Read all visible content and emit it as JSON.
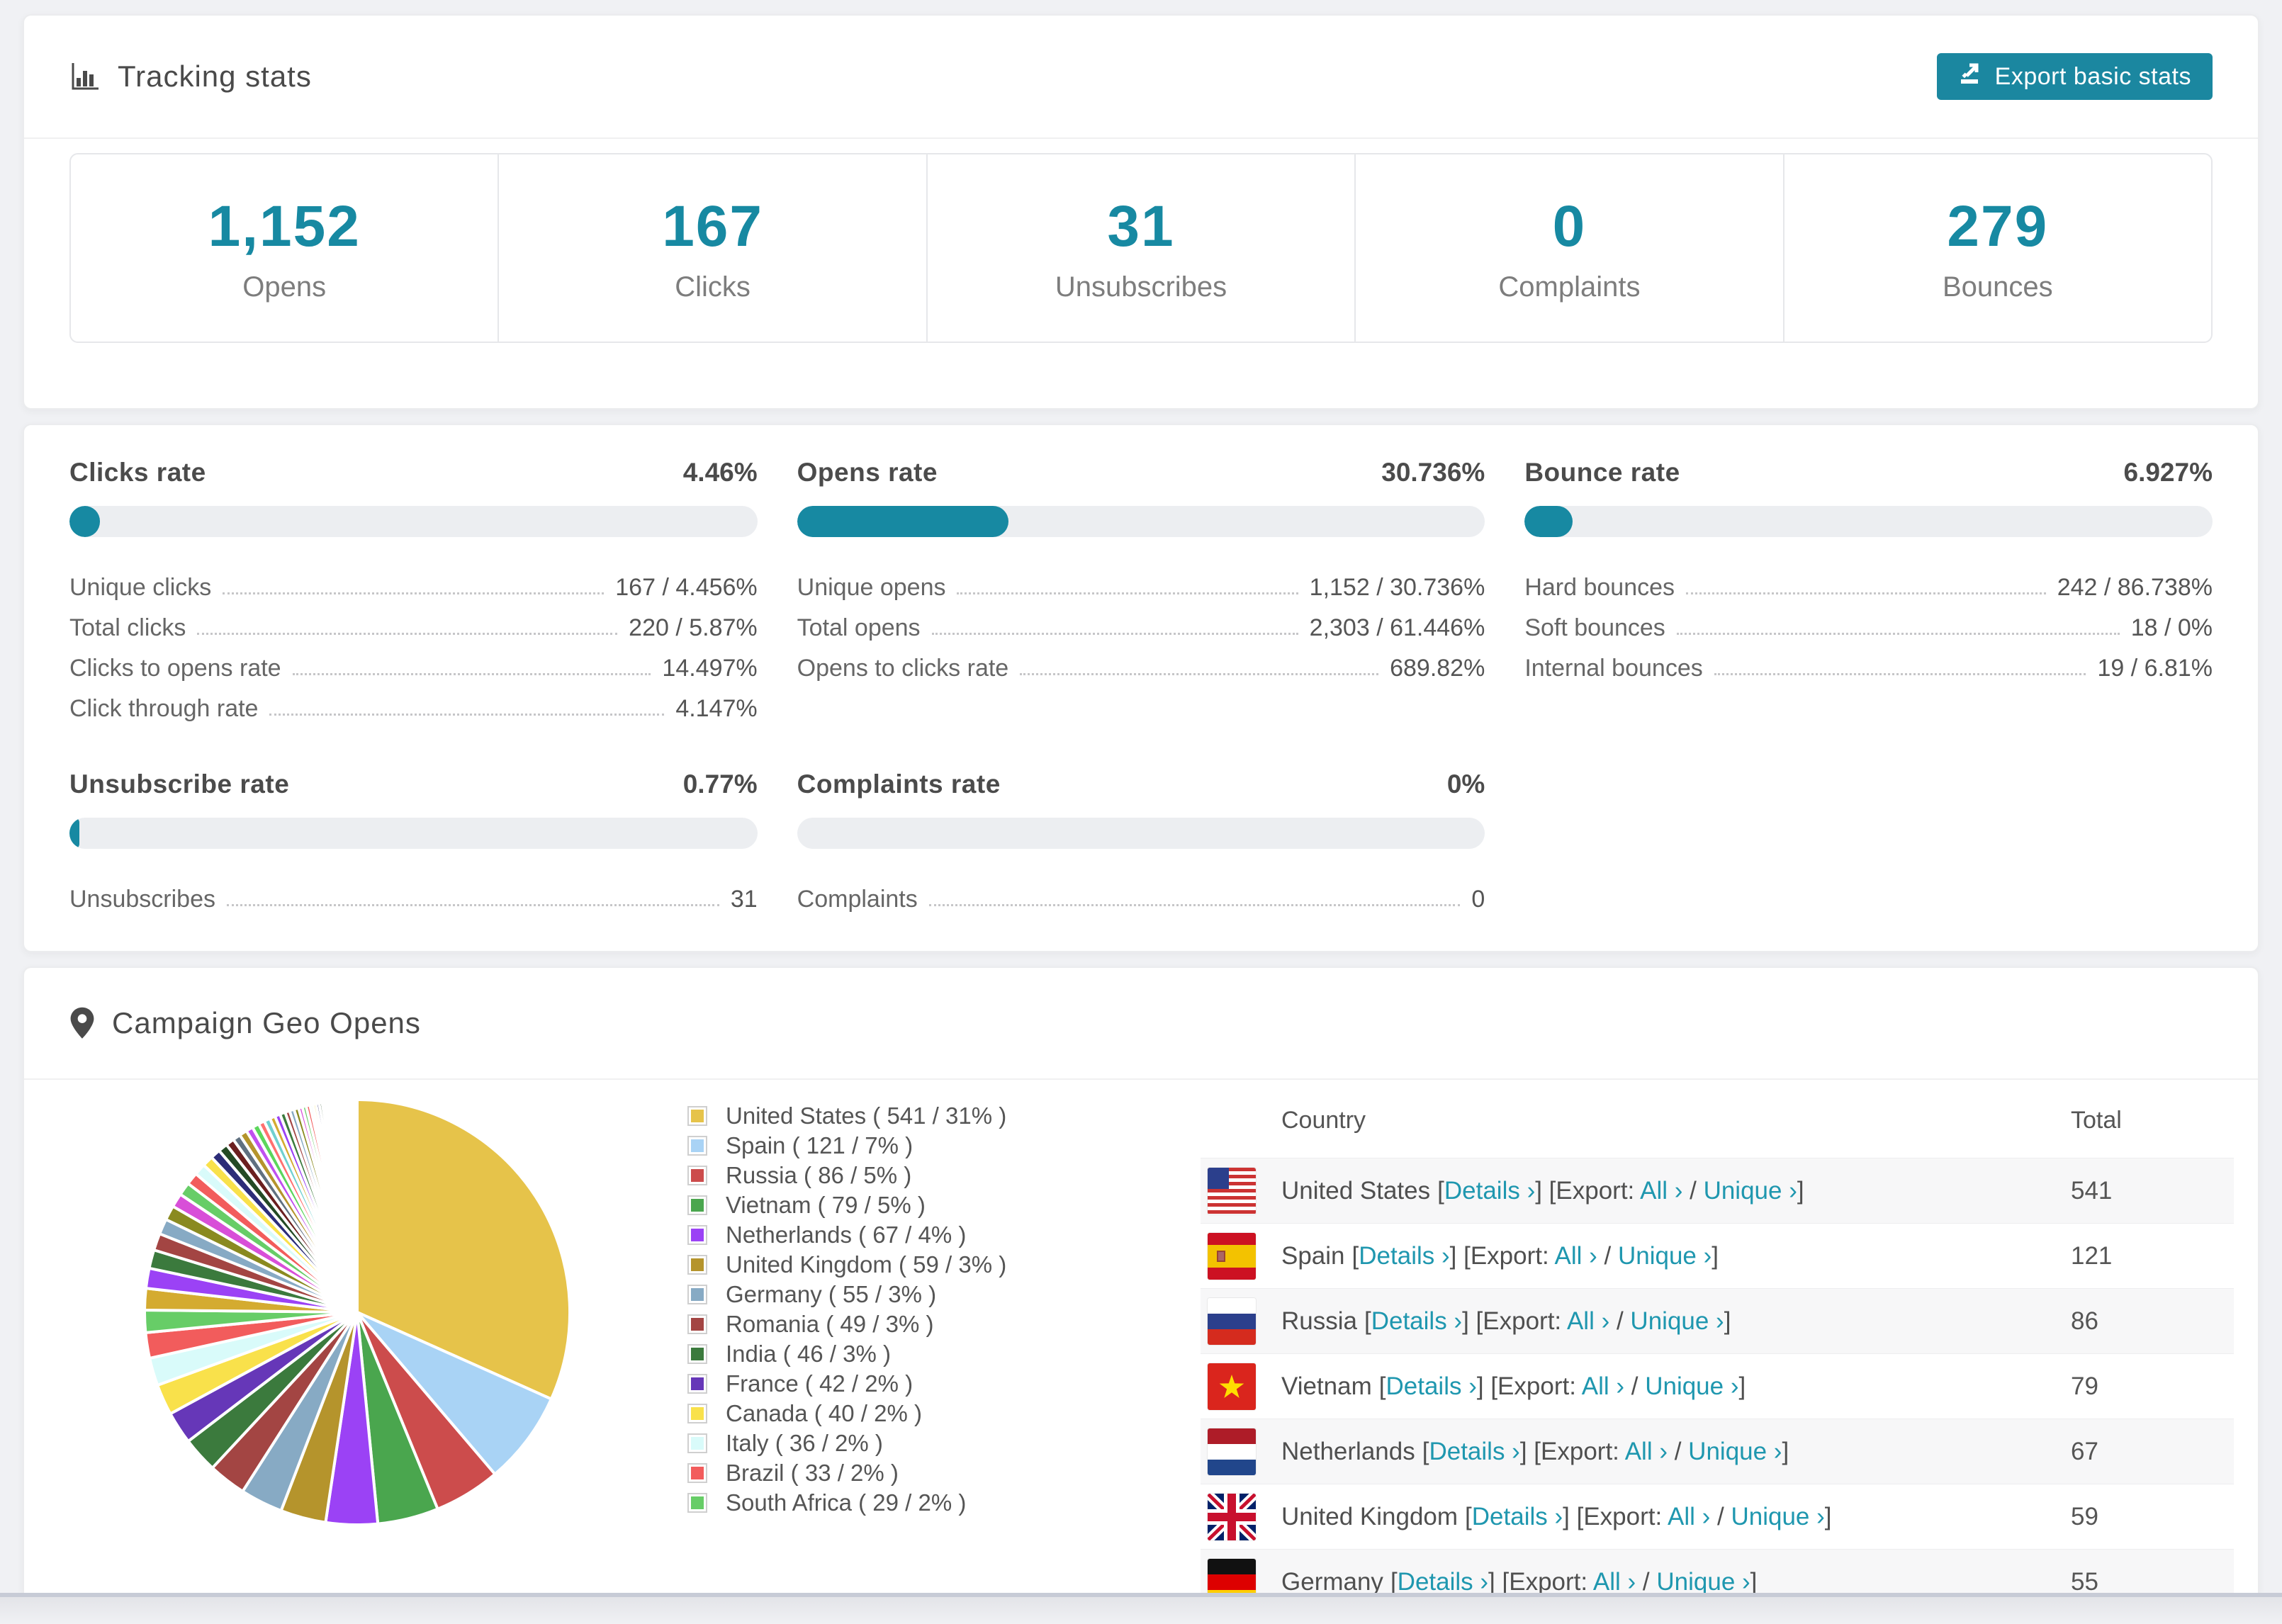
{
  "tracking": {
    "title": "Tracking stats",
    "export_button": "Export basic stats",
    "stats": [
      {
        "value": "1,152",
        "label": "Opens"
      },
      {
        "value": "167",
        "label": "Clicks"
      },
      {
        "value": "31",
        "label": "Unsubscribes"
      },
      {
        "value": "0",
        "label": "Complaints"
      },
      {
        "value": "279",
        "label": "Bounces"
      }
    ]
  },
  "rates": [
    {
      "title": "Clicks rate",
      "value": "4.46%",
      "percent": 4.46,
      "rows": [
        {
          "label": "Unique clicks",
          "value": "167 / 4.456%"
        },
        {
          "label": "Total clicks",
          "value": "220 / 5.87%"
        },
        {
          "label": "Clicks to opens rate",
          "value": "14.497%"
        },
        {
          "label": "Click through rate",
          "value": "4.147%"
        }
      ]
    },
    {
      "title": "Opens rate",
      "value": "30.736%",
      "percent": 30.736,
      "rows": [
        {
          "label": "Unique opens",
          "value": "1,152 / 30.736%"
        },
        {
          "label": "Total opens",
          "value": "2,303 / 61.446%"
        },
        {
          "label": "Opens to clicks rate",
          "value": "689.82%"
        }
      ]
    },
    {
      "title": "Bounce rate",
      "value": "6.927%",
      "percent": 6.927,
      "rows": [
        {
          "label": "Hard bounces",
          "value": "242 / 86.738%"
        },
        {
          "label": "Soft bounces",
          "value": "18 / 0%"
        },
        {
          "label": "Internal bounces",
          "value": "19 / 6.81%"
        }
      ]
    },
    {
      "title": "Unsubscribe rate",
      "value": "0.77%",
      "percent": 0.77,
      "rows": [
        {
          "label": "Unsubscribes",
          "value": "31"
        }
      ]
    },
    {
      "title": "Complaints rate",
      "value": "0%",
      "percent": 0,
      "rows": [
        {
          "label": "Complaints",
          "value": "0"
        }
      ]
    }
  ],
  "geo": {
    "title": "Campaign Geo Opens",
    "legend": [
      {
        "label": "United States ( 541 / 31% )",
        "color": "#e6c34a"
      },
      {
        "label": "Spain ( 121 / 7% )",
        "color": "#a9d3f5"
      },
      {
        "label": "Russia ( 86 / 5% )",
        "color": "#cc4c4c"
      },
      {
        "label": "Vietnam ( 79 / 5% )",
        "color": "#4aa64e"
      },
      {
        "label": "Netherlands ( 67 / 4% )",
        "color": "#9b42f5"
      },
      {
        "label": "United Kingdom ( 59 / 3% )",
        "color": "#b5942c"
      },
      {
        "label": "Germany ( 55 / 3% )",
        "color": "#87aac4"
      },
      {
        "label": "Romania ( 49 / 3% )",
        "color": "#a34543"
      },
      {
        "label": "India ( 46 / 3% )",
        "color": "#3b7a3d"
      },
      {
        "label": "France ( 42 / 2% )",
        "color": "#6637b8"
      },
      {
        "label": "Canada ( 40 / 2% )",
        "color": "#f9e14b"
      },
      {
        "label": "Italy ( 36 / 2% )",
        "color": "#d9fbfa"
      },
      {
        "label": "Brazil ( 33 / 2% )",
        "color": "#f25c5c"
      },
      {
        "label": "South Africa ( 29 / 2% )",
        "color": "#67cd67"
      }
    ],
    "table": {
      "headers": [
        "Country",
        "Total"
      ],
      "details_label": "Details ›",
      "export_label": "Export:",
      "all_label": "All ›",
      "unique_label": "Unique ›",
      "rows": [
        {
          "country": "United States",
          "flag": "us",
          "total": "541"
        },
        {
          "country": "Spain",
          "flag": "es",
          "total": "121"
        },
        {
          "country": "Russia",
          "flag": "ru",
          "total": "86"
        },
        {
          "country": "Vietnam",
          "flag": "vn",
          "total": "79"
        },
        {
          "country": "Netherlands",
          "flag": "nl",
          "total": "67"
        },
        {
          "country": "United Kingdom",
          "flag": "gb",
          "total": "59"
        },
        {
          "country": "Germany",
          "flag": "de",
          "total": "55"
        }
      ]
    }
  },
  "chart_data": {
    "type": "pie",
    "title": "Campaign Geo Opens",
    "legend_position": "right",
    "start_angle": -90,
    "direction": "clockwise",
    "labels": [
      "United States",
      "Spain",
      "Russia",
      "Vietnam",
      "Netherlands",
      "United Kingdom",
      "Germany",
      "Romania",
      "India",
      "France",
      "Canada",
      "Italy",
      "Brazil",
      "South Africa"
    ],
    "values": [
      541,
      121,
      86,
      79,
      67,
      59,
      55,
      49,
      46,
      42,
      40,
      36,
      33,
      29
    ],
    "percents": [
      31,
      7,
      5,
      5,
      4,
      3,
      3,
      3,
      3,
      2,
      2,
      2,
      2,
      2
    ],
    "colors": [
      "#e6c34a",
      "#a9d3f5",
      "#cc4c4c",
      "#4aa64e",
      "#9b42f5",
      "#b5942c",
      "#87aac4",
      "#a34543",
      "#3b7a3d",
      "#6637b8",
      "#f9e14b",
      "#d9fbfa",
      "#f25c5c",
      "#67cd67"
    ],
    "unlabeled_tail_note": "Many additional small unlabeled country slices taper clockwise back to 12 o'clock",
    "unlabeled_tail_values": [
      28,
      26,
      24,
      22,
      20,
      19,
      18,
      17,
      16,
      15,
      14,
      13,
      12,
      11,
      10,
      10,
      9,
      9,
      8,
      8,
      7,
      7,
      7,
      6,
      6,
      6,
      5,
      5,
      5,
      4,
      4,
      4,
      4,
      3,
      3,
      3,
      3,
      3,
      2,
      2,
      2,
      2,
      2,
      2,
      2,
      2,
      1,
      1,
      1,
      1,
      1,
      1,
      1,
      1,
      1,
      1,
      1,
      1,
      1,
      1
    ],
    "tail_palette": [
      "#d4ab30",
      "#9b42f5",
      "#3b7a3d",
      "#a34543",
      "#87aac4",
      "#8a8a20",
      "#d84fd8",
      "#67cd67",
      "#f25c5c",
      "#d9fbfa",
      "#f9e14b",
      "#2c2c78",
      "#244a24",
      "#6b1f1f",
      "#607080",
      "#b5942c",
      "#c050f0",
      "#5cd65c",
      "#ff7070",
      "#70d0d0"
    ]
  }
}
